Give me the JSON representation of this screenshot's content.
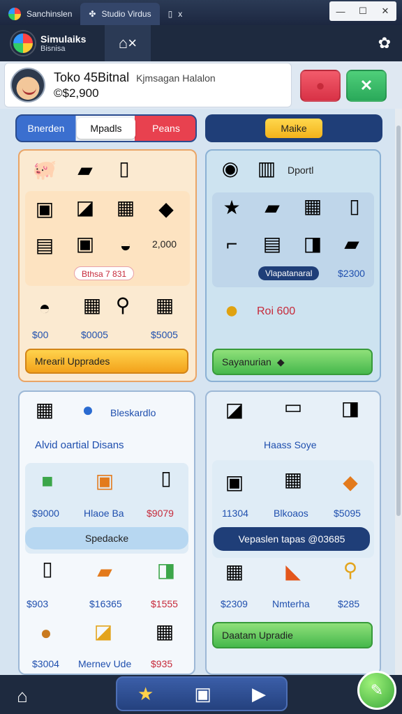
{
  "window": {
    "tab1_label": "Sanchinslen",
    "tab2_label": "Studio Virdus",
    "tab3_label": "x",
    "min": "—",
    "max": "☐",
    "close": "✕"
  },
  "app": {
    "brand_title": "Simulaiks",
    "brand_subtitle": "Bisnisa",
    "home_icon": "⌂×",
    "gear_icon": "✿"
  },
  "profile": {
    "name": "Toko 45Bitnal",
    "subtitle": "Kjmsagan Halalon",
    "cash": "©$2,900"
  },
  "topbar": {
    "seg1": "Bnerden",
    "seg2": "Mpadls",
    "seg3": "Peans",
    "right_label": "Maike"
  },
  "panel1": {
    "value_top": "2,000",
    "pill": "Bthsa 7 831",
    "price1": "$00",
    "price2": "$0005",
    "price3": "$5005",
    "button": "Mrearil   Upprades"
  },
  "panel2": {
    "header": "Dportl",
    "pill": "Vlapatanaral",
    "price": "$2300",
    "coin_label": "Roi 600",
    "button": "Sayanurian"
  },
  "panel3": {
    "header": "Bleskardlo",
    "title": "Alvid oartial Disans",
    "p1": "$9000",
    "p2": "Hlaoe Ba",
    "p3": "$9079",
    "mid_button": "Spedacke",
    "p4": "$903",
    "p5": "$16365",
    "p6": "$1555",
    "p7": "$3004",
    "p8": "Mernev Ude",
    "p9": "$935"
  },
  "panel4": {
    "title": "Haass Soye",
    "p1": "11304",
    "p2": "Blkoaos",
    "p3": "$5095",
    "mid_button": "Vepaslen tapas @03685",
    "p4": "$2309",
    "p5": "Nmterha",
    "p6": "$285",
    "button": "Daatam   Upradie"
  },
  "dock": {
    "home": "⌂",
    "star": "★",
    "box": "▣",
    "play": "▶",
    "fab": "✎"
  }
}
